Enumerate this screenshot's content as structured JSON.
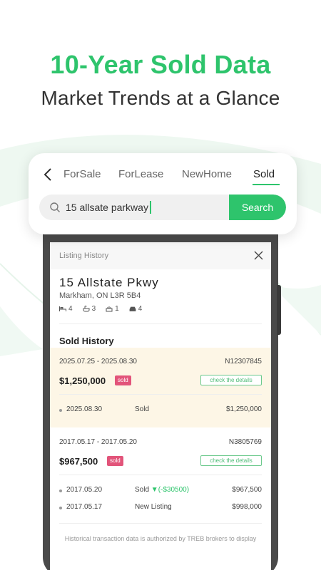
{
  "hero": {
    "title": "10-Year Sold Data",
    "subtitle": "Market Trends at a Glance"
  },
  "search_card": {
    "tabs": [
      {
        "label": "ForSale",
        "active": false
      },
      {
        "label": "ForLease",
        "active": false
      },
      {
        "label": "NewHome",
        "active": false
      },
      {
        "label": "Sold",
        "active": true
      }
    ],
    "search_value": "15 allsate parkway",
    "search_button": "Search"
  },
  "listing": {
    "header_title": "Listing History",
    "address": "15 Allstate Pkwy",
    "city": "Markham, ON L3R 5B4",
    "features": {
      "beds": "4",
      "baths": "3",
      "kitchens": "1",
      "parking": "4"
    },
    "sold_history_title": "Sold History",
    "sales": [
      {
        "date_range": "2025.07.25 - 2025.08.30",
        "mls": "N12307845",
        "price": "$1,250,000",
        "badge": "sold",
        "details_label": "check the details",
        "events": [
          {
            "date": "2025.08.30",
            "event": "Sold",
            "change": "",
            "price": "$1,250,000"
          }
        ]
      },
      {
        "date_range": "2017.05.17 - 2017.05.20",
        "mls": "N3805769",
        "price": "$967,500",
        "badge": "sold",
        "details_label": "check the details",
        "events": [
          {
            "date": "2017.05.20",
            "event": "Sold",
            "change": "▼(-$30500)",
            "price": "$967,500"
          },
          {
            "date": "2017.05.17",
            "event": "New Listing",
            "change": "",
            "price": "$998,000"
          }
        ]
      }
    ],
    "footer_note": "Historical transaction data is authorized by TREB brokers to display"
  },
  "colors": {
    "brand_green": "#2ec46c",
    "sold_badge": "#e2547a",
    "highlight_row": "#fdf6e6"
  }
}
